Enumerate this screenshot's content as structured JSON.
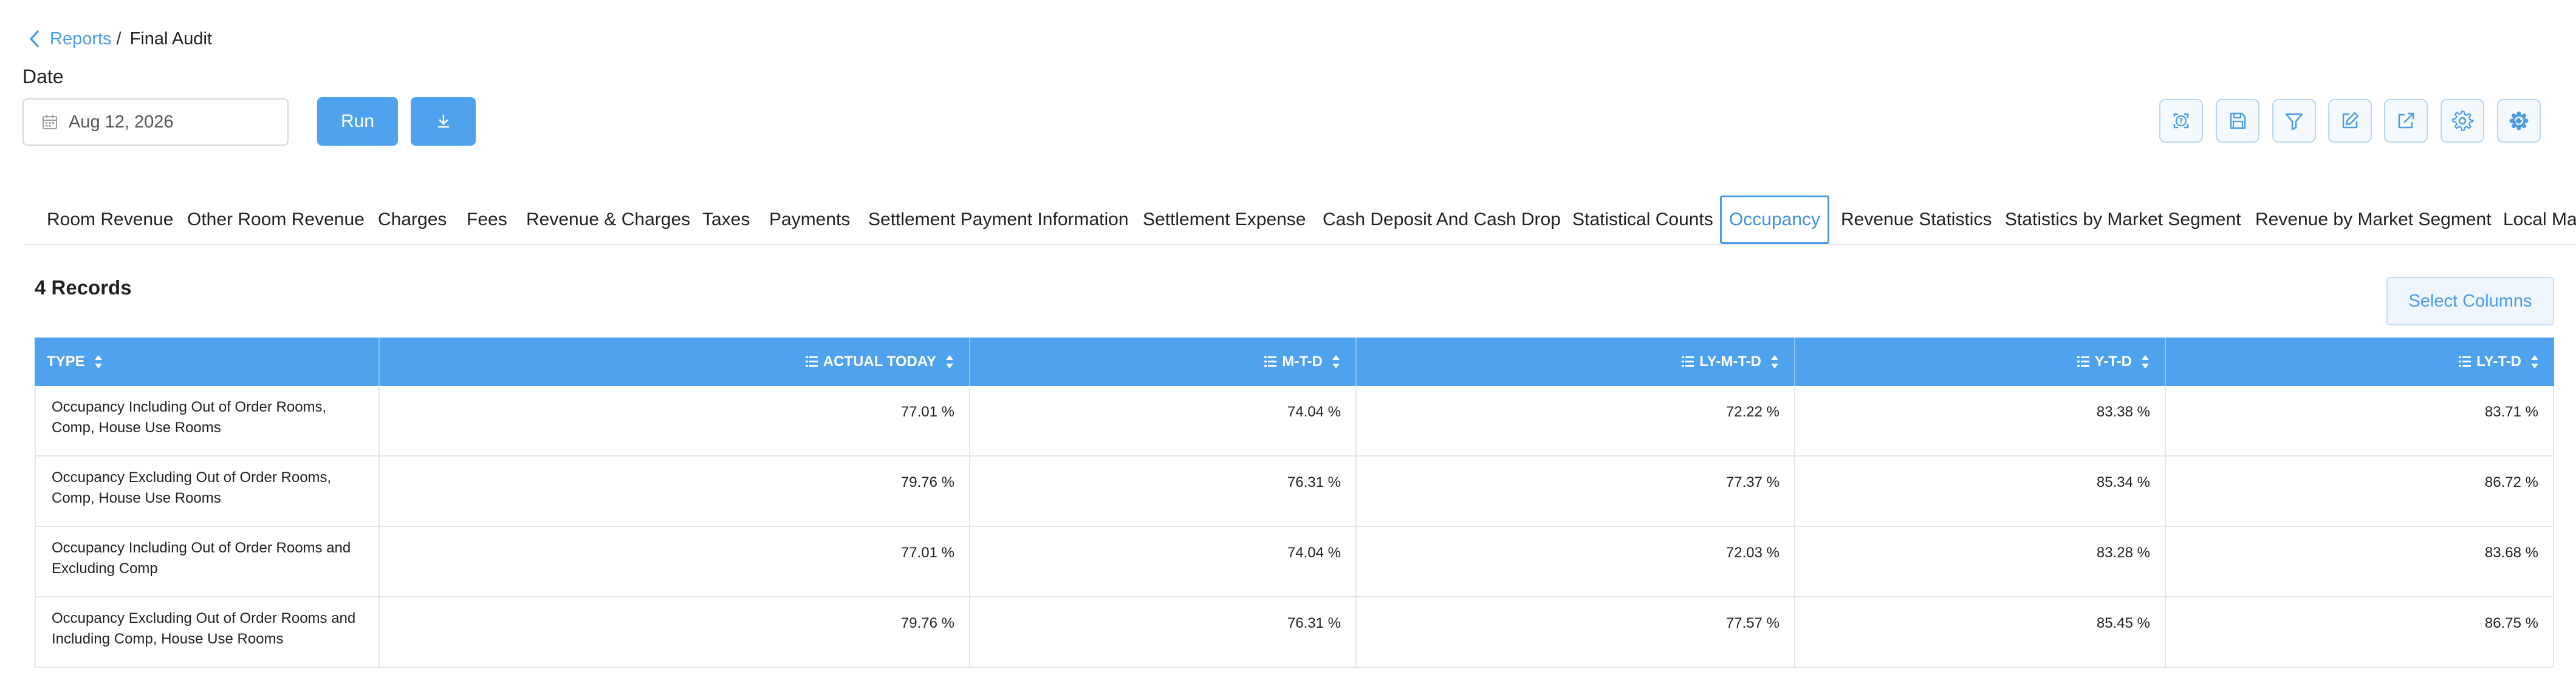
{
  "breadcrumb": {
    "back_icon": "chevron-left-icon",
    "parent": "Reports",
    "separator": "/",
    "current": "Final Audit"
  },
  "filters": {
    "date_label": "Date",
    "date_value": "Aug 12, 2026",
    "calendar_icon": "calendar-icon",
    "run_label": "Run",
    "download_icon": "download-icon"
  },
  "toolbar": {
    "icons": [
      "help-icon",
      "save-icon",
      "filter-icon",
      "edit-icon",
      "export-icon",
      "settings-icon",
      "gear-refresh-icon"
    ]
  },
  "tabs": [
    {
      "label": "Room Revenue"
    },
    {
      "label": "Other Room Revenue"
    },
    {
      "label": "Charges"
    },
    {
      "label": "Fees"
    },
    {
      "label": "Revenue & Charges"
    },
    {
      "label": "Taxes"
    },
    {
      "label": "Payments"
    },
    {
      "label": "Settlement Payment Information"
    },
    {
      "label": "Settlement Expense"
    },
    {
      "label": "Cash Deposit And Cash Drop"
    },
    {
      "label": "Statistical Counts"
    },
    {
      "label": "Occupancy",
      "active": true
    },
    {
      "label": "Revenue Statistics"
    },
    {
      "label": "Statistics by Market Segment"
    },
    {
      "label": "Revenue by Market Segment"
    },
    {
      "label": "Local Ma"
    }
  ],
  "records_label": "4 Records",
  "select_columns_label": "Select Columns",
  "table": {
    "columns": [
      "TYPE",
      "ACTUAL TODAY",
      "M-T-D",
      "LY-M-T-D",
      "Y-T-D",
      "LY-T-D"
    ],
    "rows": [
      {
        "type": [
          "Occupancy Including Out of Order Rooms,",
          "Comp, House Use Rooms"
        ],
        "values": [
          "77.01 %",
          "74.04 %",
          "72.22 %",
          "83.38 %",
          "83.71 %"
        ]
      },
      {
        "type": [
          "Occupancy Excluding Out of Order Rooms,",
          "Comp, House Use Rooms"
        ],
        "values": [
          "79.76 %",
          "76.31 %",
          "77.37 %",
          "85.34 %",
          "86.72 %"
        ]
      },
      {
        "type": [
          "Occupancy Including Out of Order Rooms and",
          "Excluding Comp"
        ],
        "values": [
          "77.01 %",
          "74.04 %",
          "72.03 %",
          "83.28 %",
          "83.68 %"
        ]
      },
      {
        "type": [
          "Occupancy Excluding Out of Order Rooms and",
          "Including Comp, House Use Rooms"
        ],
        "values": [
          "79.76 %",
          "76.31 %",
          "77.57 %",
          "85.45 %",
          "86.75 %"
        ]
      }
    ]
  },
  "colors": {
    "accent": "#4fa3ee",
    "link": "#4a9be6"
  }
}
